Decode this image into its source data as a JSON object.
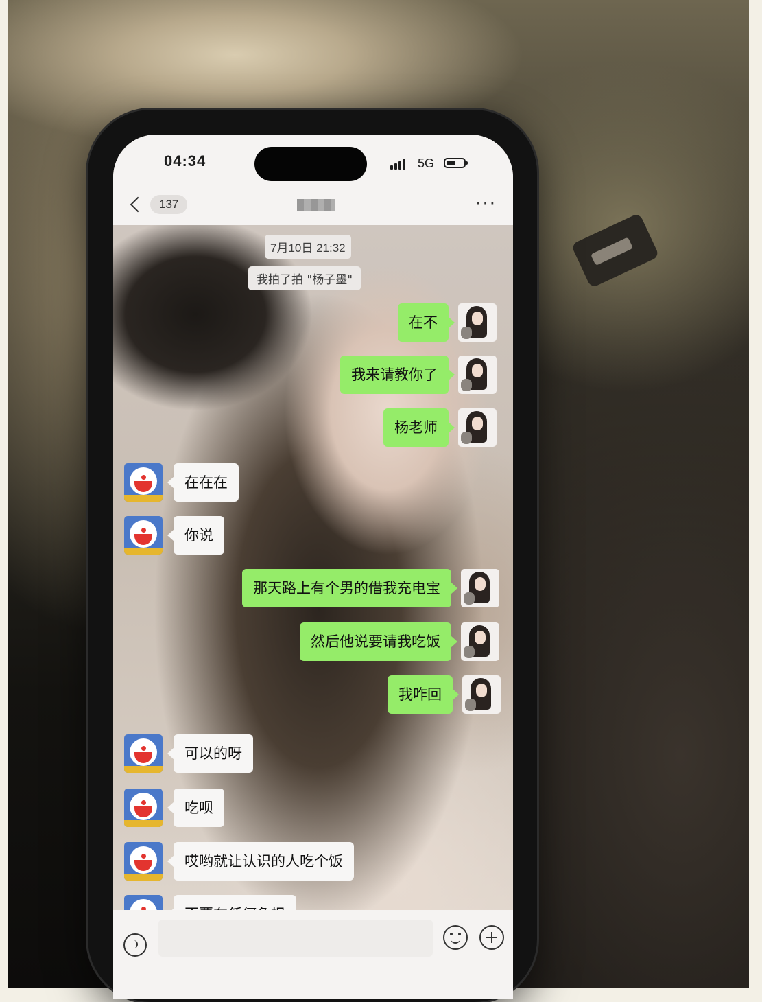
{
  "status_bar": {
    "time": "04:34",
    "network": "5G",
    "signal_icon": "signal-bars-icon",
    "battery_icon": "battery-icon"
  },
  "nav": {
    "back_icon": "chevron-left-icon",
    "unread_count": "137",
    "more_label": "···"
  },
  "chat": {
    "timestamp": "7月10日 21:32",
    "pat_notice": "我拍了拍 \"杨子墨\"",
    "messages": [
      {
        "side": "out",
        "text": "在不"
      },
      {
        "side": "out",
        "text": "我来请教你了"
      },
      {
        "side": "out",
        "text": "杨老师"
      },
      {
        "side": "in",
        "text": "在在在"
      },
      {
        "side": "in",
        "text": "你说"
      },
      {
        "side": "out",
        "text": "那天路上有个男的借我充电宝"
      },
      {
        "side": "out",
        "text": "然后他说要请我吃饭"
      },
      {
        "side": "out",
        "text": "我咋回"
      },
      {
        "side": "in",
        "text": "可以的呀"
      },
      {
        "side": "in",
        "text": "吃呗"
      },
      {
        "side": "in",
        "text": "哎哟就让认识的人吃个饭"
      },
      {
        "side": "in",
        "text": "不要有任何负担"
      }
    ]
  },
  "input_bar": {
    "voice_icon": "voice-icon",
    "emoji_icon": "emoji-icon",
    "plus_icon": "plus-icon",
    "placeholder": ""
  },
  "colors": {
    "outgoing_bubble": "#95ec69",
    "incoming_bubble": "#f7f6f5",
    "bar_background": "#f5f3f2"
  }
}
